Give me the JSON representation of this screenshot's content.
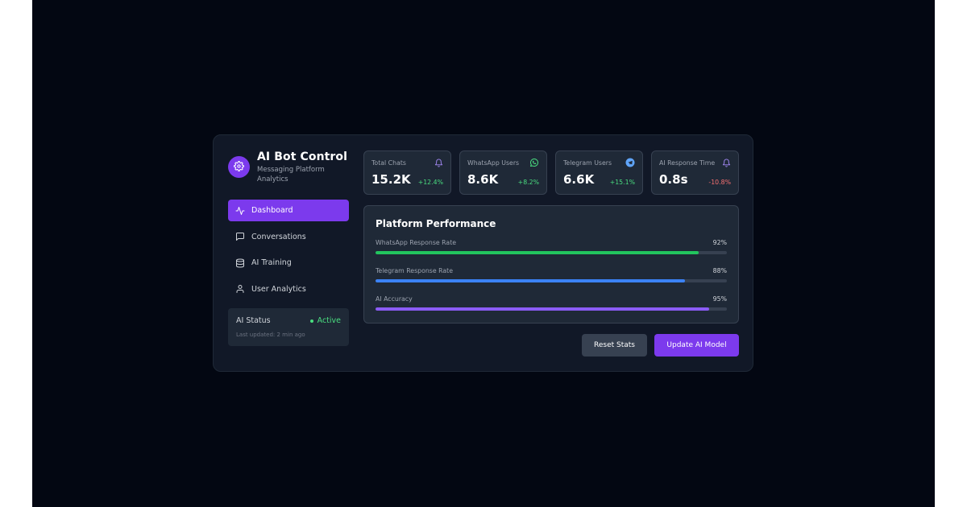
{
  "brand": {
    "title": "AI Bot Control",
    "subtitle": "Messaging Platform Analytics",
    "icon": "gear-icon",
    "accent": "#7c3aed"
  },
  "nav": {
    "items": [
      {
        "label": "Dashboard",
        "icon": "activity-icon",
        "active": true
      },
      {
        "label": "Conversations",
        "icon": "chat-icon",
        "active": false
      },
      {
        "label": "AI Training",
        "icon": "database-icon",
        "active": false
      },
      {
        "label": "User Analytics",
        "icon": "user-icon",
        "active": false
      }
    ]
  },
  "status": {
    "label": "AI Status",
    "value": "Active",
    "updated": "Last updated: 2 min ago",
    "color": "#4ade80"
  },
  "stats": [
    {
      "label": "Total Chats",
      "value": "15.2K",
      "change": "+12.4%",
      "trend": "up",
      "icon": "bell-icon"
    },
    {
      "label": "WhatsApp Users",
      "value": "8.6K",
      "change": "+8.2%",
      "trend": "up",
      "icon": "whatsapp-icon"
    },
    {
      "label": "Telegram Users",
      "value": "6.6K",
      "change": "+15.1%",
      "trend": "up",
      "icon": "telegram-icon"
    },
    {
      "label": "AI Response Time",
      "value": "0.8s",
      "change": "-10.8%",
      "trend": "down",
      "icon": "bell-icon"
    }
  ],
  "performance": {
    "title": "Platform Performance",
    "metrics": [
      {
        "label": "WhatsApp Response Rate",
        "pct_label": "92%",
        "value": 92,
        "color": "#22c55e"
      },
      {
        "label": "Telegram Response Rate",
        "pct_label": "88%",
        "value": 88,
        "color": "#3b82f6"
      },
      {
        "label": "AI Accuracy",
        "pct_label": "95%",
        "value": 95,
        "color": "#8b5cf6"
      }
    ]
  },
  "actions": {
    "reset_label": "Reset Stats",
    "update_label": "Update AI Model"
  }
}
